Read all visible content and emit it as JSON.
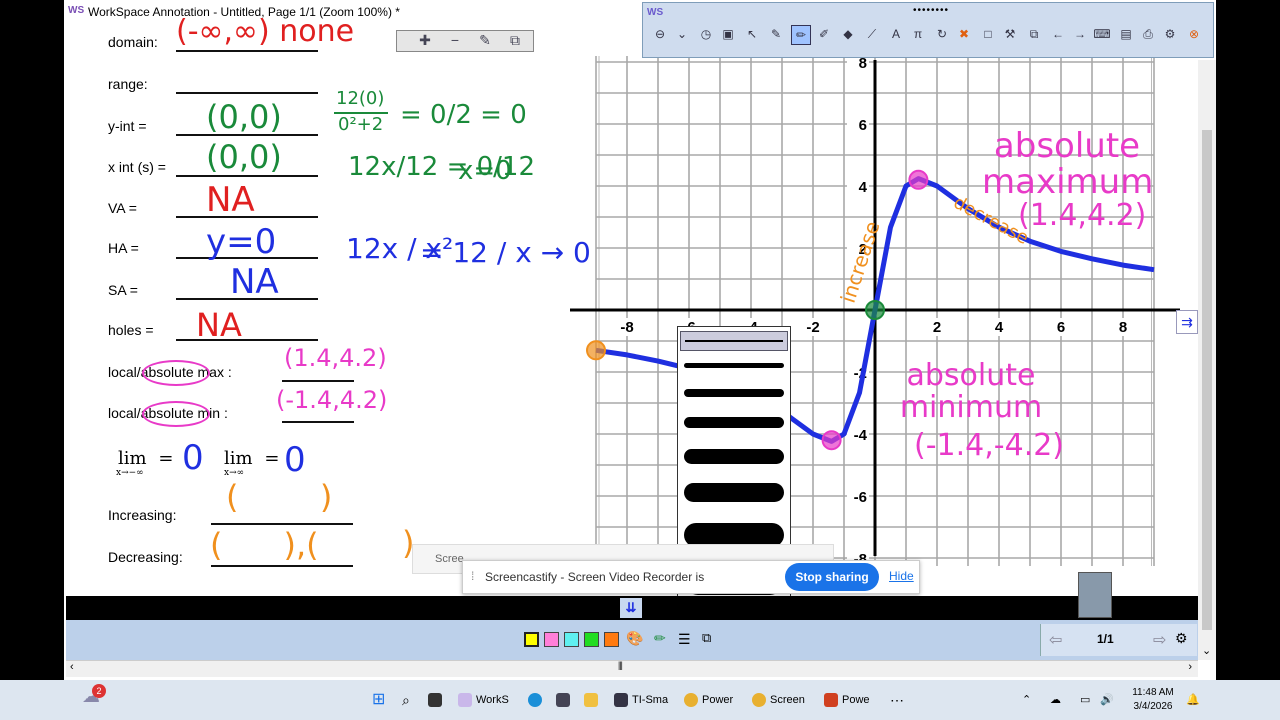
{
  "window": {
    "title": "WorkSpace Annotation - Untitled, Page 1/1  (Zoom 100%) *"
  },
  "worksheet": {
    "labels": {
      "domain": "domain:",
      "range": "range:",
      "yint": "y-int =",
      "xint": "x int (s) =",
      "va": "VA =",
      "ha": "HA =",
      "sa": "SA =",
      "holes": "holes =",
      "localmax": "local/absolute max :",
      "localmin": "local/absolute min :",
      "increasing": "Increasing:",
      "decreasing": "Decreasing:"
    },
    "limits": {
      "lim_word": "lim",
      "left_sub": "x→−∞",
      "right_sub": "x→∞",
      "equals": "="
    }
  },
  "handwriting": {
    "domain": "(-∞,∞) none",
    "yint": "(0,0)",
    "yint_calc_num": "12(0)",
    "yint_calc_den": "0²+2",
    "yint_calc_rest": "= 0/2 = 0",
    "xint": "(0,0)",
    "xint_calc": "12x/12 = 0/12",
    "xint_result": "x=0",
    "va": "NA",
    "ha": "y=0",
    "ha_calc_left": "12x / x²",
    "ha_calc_right": "= 12 / x → 0",
    "sa": "NA",
    "holes": "NA",
    "max": "(1.4,4.2)",
    "min": "(-1.4,4.2)",
    "lim_left": "0",
    "lim_right": "0",
    "abs_max": "absolute maximum",
    "abs_max_point": "(1.4,4.2)",
    "abs_min": "absolute minimum",
    "abs_min_point": "(-1.4,-4.2)",
    "decrease": "decrease",
    "increase": "increase"
  },
  "chart_data": {
    "type": "line",
    "xlim": [
      -9,
      9
    ],
    "ylim": [
      -9,
      9
    ],
    "xticks": [
      -8,
      -6,
      -4,
      -2,
      2,
      4,
      6,
      8
    ],
    "yticks": [
      8,
      6,
      4,
      2,
      -2,
      -4,
      -6,
      -8
    ],
    "grid": true,
    "function": "12x/(x^2+2)",
    "series": [
      {
        "x": [
          -9,
          -8,
          -7,
          -6,
          -5,
          -4,
          -3,
          -2,
          -1.4,
          -1,
          -0.5,
          0,
          0.5,
          1,
          1.4,
          2,
          3,
          4,
          5,
          6,
          7,
          8,
          9
        ],
        "y": [
          -1.3,
          -1.45,
          -1.65,
          -1.89,
          -2.22,
          -2.67,
          -3.27,
          -4.0,
          -4.24,
          -4.0,
          -2.67,
          0,
          2.67,
          4.0,
          4.24,
          4.0,
          3.27,
          2.67,
          2.22,
          1.89,
          1.65,
          1.45,
          1.3
        ]
      }
    ],
    "marked_points": [
      {
        "x": -9,
        "y": -1.3
      },
      {
        "x": -1.4,
        "y": -4.2
      },
      {
        "x": 0,
        "y": 0
      },
      {
        "x": 1.4,
        "y": 4.2
      }
    ],
    "colors": {
      "curve": "#1f2fe0",
      "max_point": "#e83ac8",
      "origin": "#1a8a3a",
      "endpoint": "#f0901e"
    }
  },
  "toolbar": {
    "logo": "WS",
    "grip": "••••••••"
  },
  "notification": {
    "ghost": "Scree",
    "text": "Screencastify - Screen Video Recorder is",
    "stop": "Stop sharing",
    "hide": "Hide"
  },
  "pager": {
    "page": "1/1"
  },
  "taskbar": {
    "badge": "2",
    "items": [
      "WorkS",
      "TI-Sma",
      "Power",
      "Screen",
      "Powe"
    ],
    "more": "⋯",
    "time": "11:48 AM",
    "date": "3/4/2026"
  },
  "colors": {
    "green": "#1a8a3a",
    "red": "#e02020",
    "blue": "#1f2fe0",
    "magenta": "#e83ac8",
    "orange": "#f0901e"
  }
}
